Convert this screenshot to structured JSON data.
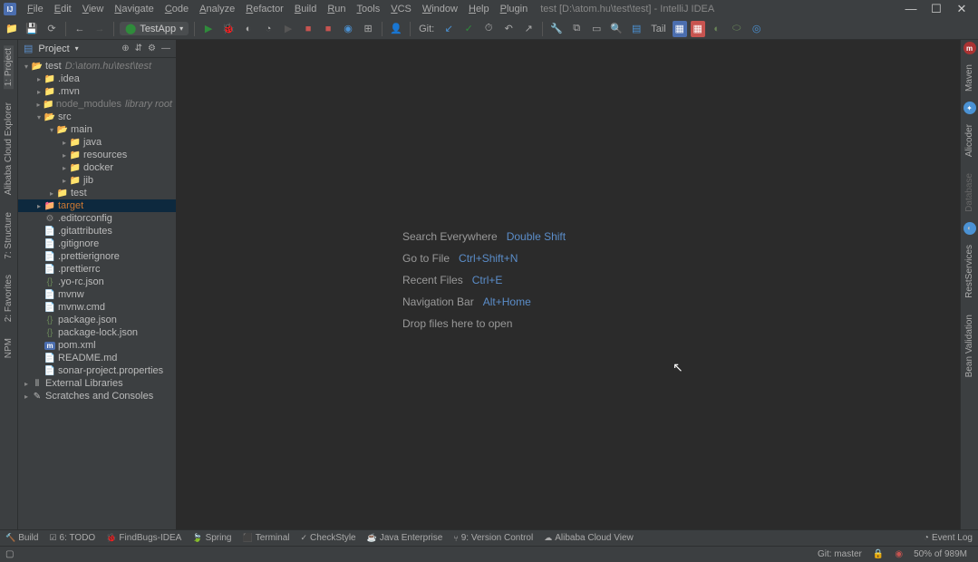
{
  "title": {
    "path": "test [D:\\atom.hu\\test\\test]",
    "app": "IntelliJ IDEA"
  },
  "menu": [
    "File",
    "Edit",
    "View",
    "Navigate",
    "Code",
    "Analyze",
    "Refactor",
    "Build",
    "Run",
    "Tools",
    "VCS",
    "Window",
    "Help",
    "Plugin"
  ],
  "toolbar": {
    "runcfg": "TestApp",
    "git": "Git:",
    "tail": "Tail"
  },
  "project_header": {
    "label": "Project"
  },
  "tree": [
    {
      "d": 0,
      "a": "▾",
      "i": "folder-open",
      "t": "test",
      "extra": "D:\\atom.hu\\test\\test",
      "sel": true
    },
    {
      "d": 1,
      "a": "▸",
      "i": "folder",
      "t": ".idea"
    },
    {
      "d": 1,
      "a": "▸",
      "i": "folder",
      "t": ".mvn"
    },
    {
      "d": 1,
      "a": "▸",
      "i": "folder",
      "t": "node_modules",
      "extra": "library root",
      "dim": true
    },
    {
      "d": 1,
      "a": "▾",
      "i": "folder-open",
      "t": "src"
    },
    {
      "d": 2,
      "a": "▾",
      "i": "folder-open",
      "t": "main"
    },
    {
      "d": 3,
      "a": "▸",
      "i": "java-icon",
      "t": "java"
    },
    {
      "d": 3,
      "a": "▸",
      "i": "folder",
      "t": "resources"
    },
    {
      "d": 3,
      "a": "▸",
      "i": "folder",
      "t": "docker"
    },
    {
      "d": 3,
      "a": "▸",
      "i": "folder",
      "t": "jib"
    },
    {
      "d": 2,
      "a": "▸",
      "i": "folder",
      "t": "test"
    },
    {
      "d": 1,
      "a": "▸",
      "i": "orange",
      "t": "target",
      "sel2": true
    },
    {
      "d": 1,
      "a": "",
      "i": "gear-icon",
      "t": ".editorconfig"
    },
    {
      "d": 1,
      "a": "",
      "i": "file",
      "t": ".gitattributes"
    },
    {
      "d": 1,
      "a": "",
      "i": "file",
      "t": ".gitignore"
    },
    {
      "d": 1,
      "a": "",
      "i": "file",
      "t": ".prettierignore"
    },
    {
      "d": 1,
      "a": "",
      "i": "file",
      "t": ".prettierrc"
    },
    {
      "d": 1,
      "a": "",
      "i": "json-icon",
      "t": ".yo-rc.json"
    },
    {
      "d": 1,
      "a": "",
      "i": "file",
      "t": "mvnw"
    },
    {
      "d": 1,
      "a": "",
      "i": "file",
      "t": "mvnw.cmd"
    },
    {
      "d": 1,
      "a": "",
      "i": "json-icon",
      "t": "package.json"
    },
    {
      "d": 1,
      "a": "",
      "i": "json-icon",
      "t": "package-lock.json"
    },
    {
      "d": 1,
      "a": "",
      "i": "m-icon",
      "t": "pom.xml"
    },
    {
      "d": 1,
      "a": "",
      "i": "file",
      "t": "README.md"
    },
    {
      "d": 1,
      "a": "",
      "i": "file",
      "t": "sonar-project.properties"
    },
    {
      "d": 0,
      "a": "▸",
      "i": "lib",
      "t": "External Libraries"
    },
    {
      "d": 0,
      "a": "▸",
      "i": "scratch",
      "t": "Scratches and Consoles"
    }
  ],
  "welcome": [
    {
      "label": "Search Everywhere",
      "shortcut": "Double Shift"
    },
    {
      "label": "Go to File",
      "shortcut": "Ctrl+Shift+N"
    },
    {
      "label": "Recent Files",
      "shortcut": "Ctrl+E"
    },
    {
      "label": "Navigation Bar",
      "shortcut": "Alt+Home"
    },
    {
      "label": "Drop files here to open",
      "shortcut": ""
    }
  ],
  "left_tools": [
    {
      "label": "1: Project"
    },
    {
      "label": "Alibaba Cloud Explorer"
    },
    {
      "label": "7: Structure"
    },
    {
      "label": "2: Favorites"
    },
    {
      "label": "NPM"
    }
  ],
  "right_tools": [
    "Maven",
    "Alicoder",
    "Database",
    "RestServices",
    "Bean Validation"
  ],
  "bottom_tools": [
    "Build",
    "6: TODO",
    "FindBugs-IDEA",
    "Spring",
    "Terminal",
    "CheckStyle",
    "Java Enterprise",
    "9: Version Control",
    "Alibaba Cloud View"
  ],
  "bottom_right": "Event Log",
  "status": {
    "git": "Git: master",
    "mem": "50% of 989M"
  }
}
